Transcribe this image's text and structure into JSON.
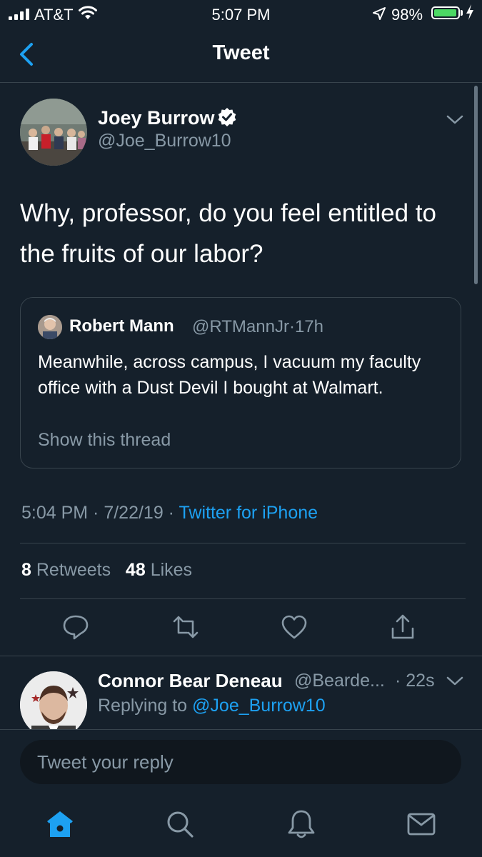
{
  "status_bar": {
    "carrier": "AT&T",
    "time": "5:07 PM",
    "battery_percent": "98%",
    "battery_level": 0.98,
    "icons": [
      "signal-icon",
      "wifi-icon",
      "location-arrow-icon",
      "battery-icon",
      "charging-bolt-icon"
    ]
  },
  "nav": {
    "title": "Tweet",
    "back_icon": "chevron-left-icon"
  },
  "tweet": {
    "author_name": "Joey Burrow",
    "author_handle": "@Joe_Burrow10",
    "verified": true,
    "text": "Why, professor, do you feel entitled to the fruits of our labor?",
    "quoted": {
      "author_name": "Robert Mann",
      "author_handle": "@RTMannJr",
      "separator": "·",
      "time": "17h",
      "text": "Meanwhile, across campus, I vacuum my faculty office with a Dust Devil I bought at Walmart.",
      "show_thread": "Show this thread"
    },
    "timestamp": "5:04 PM · 7/22/19 · ",
    "source": "Twitter for iPhone",
    "retweets_count": "8",
    "retweets_label": "Retweets",
    "likes_count": "48",
    "likes_label": "Likes",
    "actions": [
      "reply-icon",
      "retweet-icon",
      "like-icon",
      "share-icon"
    ]
  },
  "reply": {
    "author_name": "Connor Bear Deneau",
    "author_handle": "@Bearde...",
    "time": "· 22s",
    "replying_prefix": "Replying to ",
    "replying_to": "@Joe_Burrow10"
  },
  "composer": {
    "placeholder": "Tweet your reply"
  },
  "tab_bar": {
    "items": [
      "home-icon",
      "search-icon",
      "notifications-icon",
      "messages-icon"
    ],
    "active": "home-icon"
  },
  "colors": {
    "background": "#15202b",
    "accent": "#1da1f2",
    "secondary_text": "#8899a6",
    "border": "#38444d",
    "battery_green": "#4cd964"
  }
}
